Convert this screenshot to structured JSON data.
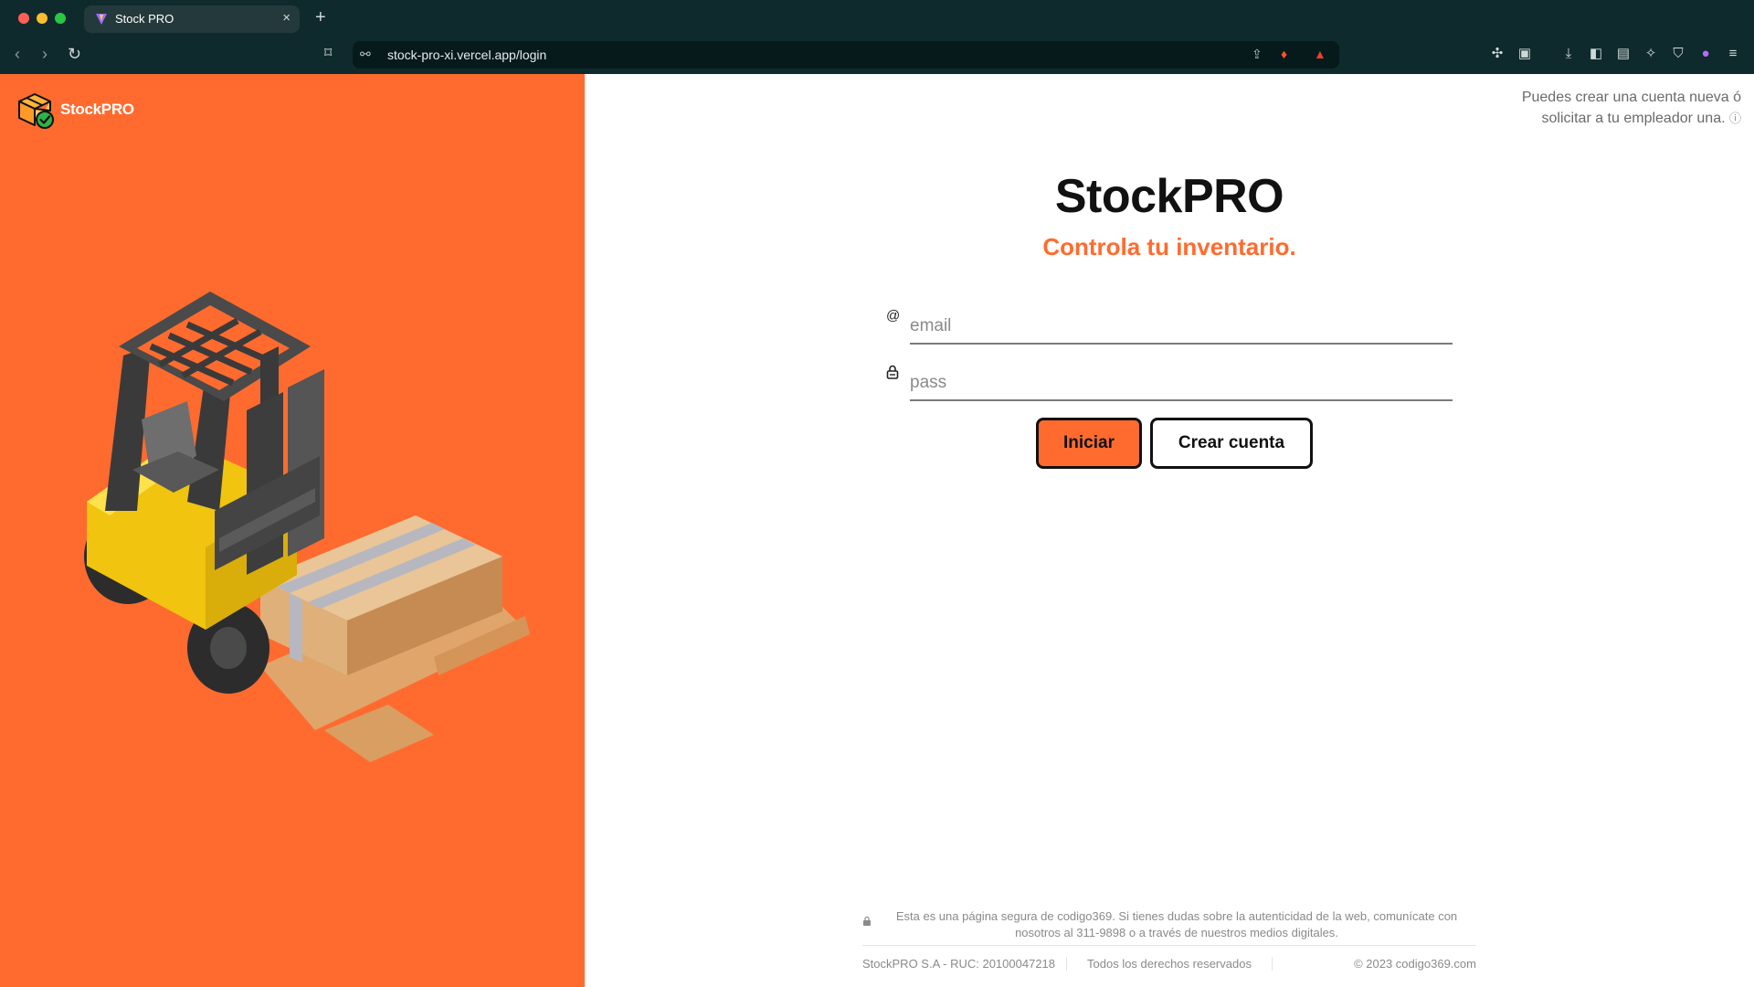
{
  "browser": {
    "tab_title": "Stock PRO",
    "url": "stock-pro-xi.vercel.app/login",
    "new_tab": "+",
    "close_tab": "×"
  },
  "brand": {
    "name": "StockPRO",
    "color": "#ff6b2f"
  },
  "helper": {
    "line1": "Puedes crear una cuenta nueva ó",
    "line2": "solicitar a tu empleador una."
  },
  "hero": {
    "title": "StockPRO",
    "subtitle": "Controla tu inventario."
  },
  "form": {
    "email_placeholder": "email",
    "pass_placeholder": "pass",
    "email_icon": "@",
    "login_label": "Iniciar",
    "register_label": "Crear cuenta"
  },
  "footer": {
    "security_line1": "Esta es una página segura de codigo369. Si tienes dudas sobre la autenticidad de la web, comunícate con",
    "security_line2": "nosotros al 311-9898 o a través de nuestros medios digitales.",
    "company": "StockPRO S.A - RUC: 20100047218",
    "rights": "Todos los derechos reservados",
    "copyright": "© 2023 codigo369.com"
  }
}
